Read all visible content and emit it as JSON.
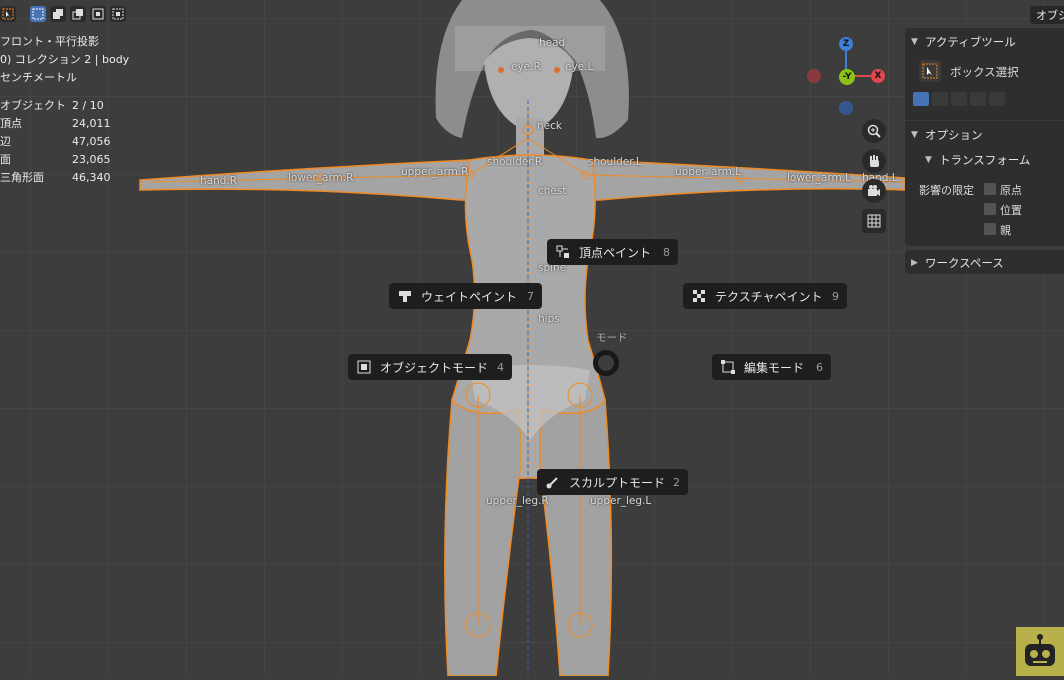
{
  "toolbar": {
    "active_select": "select-box-icon"
  },
  "header": {
    "mode_button": "オブジ"
  },
  "stats": {
    "view_name": "フロント・平行投影",
    "collection": "0) コレクション 2 | body",
    "units": "センチメートル",
    "rows": [
      {
        "key": "オブジェクト",
        "value": "2 / 10"
      },
      {
        "key": "頂点",
        "value": "24,011"
      },
      {
        "key": "辺",
        "value": "47,056"
      },
      {
        "key": "面",
        "value": "23,065"
      },
      {
        "key": "三角形面",
        "value": "46,340"
      }
    ]
  },
  "bones": {
    "head": "head",
    "eye_r": "eye.R",
    "eye_l": "eye.L",
    "neck": "neck",
    "shoulder_r": "shoulder.R",
    "shoulder_l": "shoulder.L",
    "upper_arm_r": "upper_arm.R",
    "upper_arm_l": "upper_arm.L",
    "lower_arm_r": "lower_arm.R",
    "lower_arm_l": "lower_arm.L",
    "hand_r": "hand.R",
    "hand_l": "hand.L",
    "chest": "chest",
    "spine": "spine",
    "hips": "hips",
    "upper_leg_r": "upper_leg.R",
    "upper_leg_l": "upper_leg.L"
  },
  "pie_menu": {
    "title": "モード",
    "items": {
      "vertex_paint": {
        "label": "頂点ペイント",
        "key": "8"
      },
      "weight_paint": {
        "label": "ウェイトペイント",
        "key": "7"
      },
      "texture_paint": {
        "label": "テクスチャペイント",
        "key": "9"
      },
      "object_mode": {
        "label": "オブジェクトモード",
        "key": "4"
      },
      "edit_mode": {
        "label": "編集モード",
        "key": "6"
      },
      "sculpt_mode": {
        "label": "スカルプトモード",
        "key": "2"
      }
    }
  },
  "gizmo": {
    "z": "Z",
    "y": "-Y",
    "x": "X"
  },
  "sidebar": {
    "active_tool_header": "アクティブツール",
    "box_select": "ボックス選択",
    "options_header": "オプション",
    "transform_header": "トランスフォーム",
    "affect_only": "影響の限定",
    "origins": "原点",
    "locations": "位置",
    "parents": "親",
    "workspace_header": "ワークスペース"
  },
  "colors": {
    "viewport_bg": "#3d3d3d",
    "selection_outline": "#f08a24",
    "active_blue": "#4772b3",
    "gizmo_x": "#e0474f",
    "gizmo_y": "#8bc314",
    "gizmo_z": "#3f7fd8"
  }
}
